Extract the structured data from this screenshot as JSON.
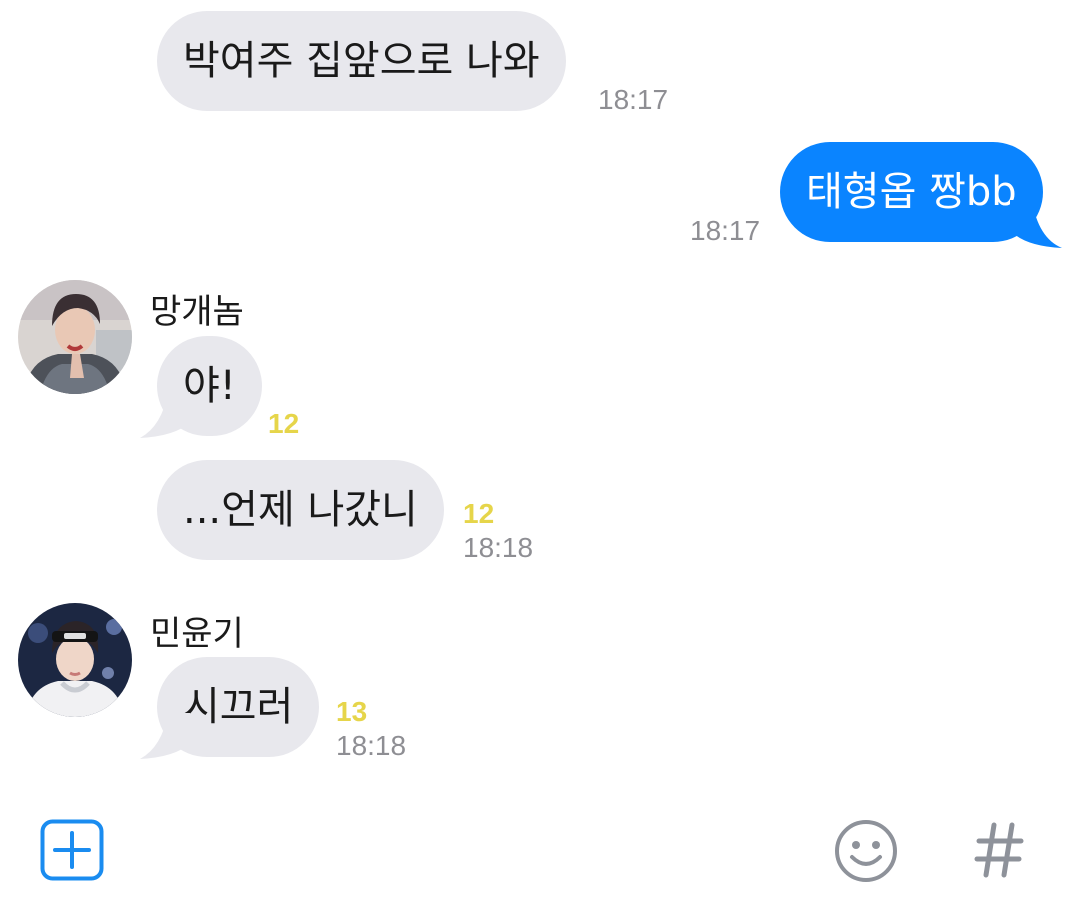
{
  "messages": [
    {
      "type": "incoming",
      "text": "박여주 집앞으로 나와",
      "time": "18:17"
    },
    {
      "type": "outgoing",
      "text": "태형옵 짱bb",
      "time": "18:17"
    },
    {
      "type": "incoming",
      "sender": "망개놈",
      "avatar": "jimin-avatar",
      "text": "야!",
      "unread": "12"
    },
    {
      "type": "incoming",
      "text": "...언제 나갔니",
      "unread": "12",
      "time": "18:18"
    },
    {
      "type": "incoming",
      "sender": "민윤기",
      "avatar": "yoongi-avatar",
      "text": "시끄러",
      "unread": "13",
      "time": "18:18"
    }
  ],
  "toolbar": {
    "attach_icon": "plus-square-icon",
    "emoji_icon": "smiley-icon",
    "hashtag_icon": "hashtag-icon"
  },
  "colors": {
    "incoming_bubble": "#e8e8ed",
    "outgoing_bubble": "#0a84ff",
    "unread": "#e6d54a",
    "timestamp": "#8e8e93",
    "accent": "#1a8cf0"
  }
}
